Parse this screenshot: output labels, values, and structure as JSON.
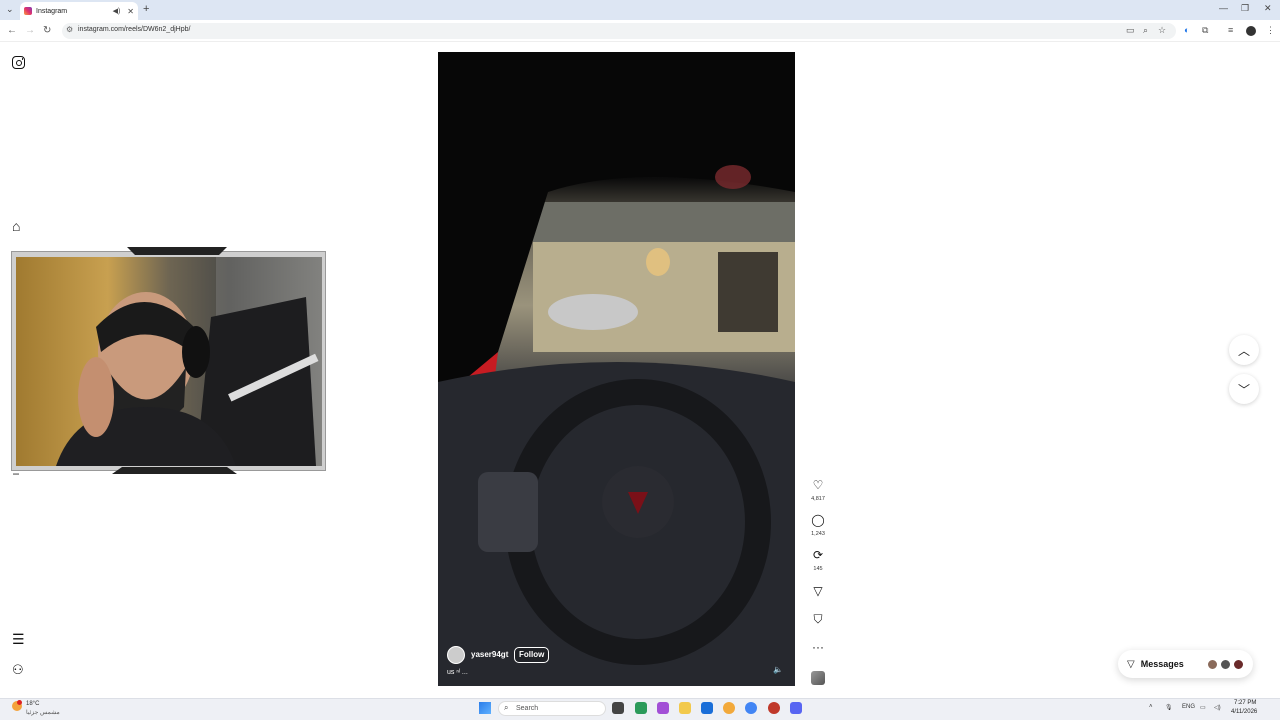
{
  "browser": {
    "tab_title": "Instagram",
    "url": "instagram.com/reels/DW6n2_djHpb/"
  },
  "reel": {
    "username": "yaser94gt",
    "follow_label": "Follow",
    "caption": "us ⁿˡ ..."
  },
  "actions": {
    "likes": "4,817",
    "comments": "1,243",
    "reposts": "145"
  },
  "messages": {
    "label": "Messages"
  },
  "taskbar": {
    "weather_temp": "18°C",
    "weather_desc": "مشمس جزئيا",
    "search_placeholder": "Search",
    "lang": "ENG",
    "time": "7:27 PM",
    "date": "4/11/2026"
  },
  "icons": {
    "instagram": "instagram-logo",
    "home": "home-icon",
    "menu": "menu-icon",
    "apps": "apps-icon"
  }
}
